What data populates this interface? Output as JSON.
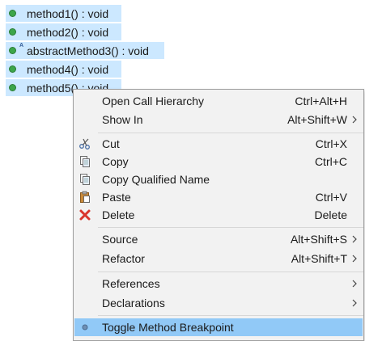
{
  "outline": {
    "items": [
      {
        "label": "method1() : void",
        "icon": "method-public-icon"
      },
      {
        "label": "method2() : void",
        "icon": "method-public-icon"
      },
      {
        "label": "abstractMethod3() : void",
        "icon": "method-abstract-icon",
        "badge": "A"
      },
      {
        "label": "method4() : void",
        "icon": "method-public-icon"
      },
      {
        "label": "method5() : void",
        "icon": "method-public-icon"
      }
    ],
    "selection_color": "#cce8ff",
    "method_icon_color": "#3da64a"
  },
  "context_menu": {
    "items": [
      {
        "label": "Open Call Hierarchy",
        "shortcut": "Ctrl+Alt+H"
      },
      {
        "label": "Show In",
        "shortcut": "Alt+Shift+W",
        "submenu": true
      },
      {
        "label": "Cut",
        "shortcut": "Ctrl+X",
        "icon": "scissors-icon"
      },
      {
        "label": "Copy",
        "shortcut": "Ctrl+C",
        "icon": "copy-icon"
      },
      {
        "label": "Copy Qualified Name",
        "shortcut": "",
        "icon": "copy-qualified-name-icon"
      },
      {
        "label": "Paste",
        "shortcut": "Ctrl+V",
        "icon": "paste-icon"
      },
      {
        "label": "Delete",
        "shortcut": "Delete",
        "icon": "delete-x-icon"
      },
      {
        "label": "Source",
        "shortcut": "Alt+Shift+S",
        "submenu": true
      },
      {
        "label": "Refactor",
        "shortcut": "Alt+Shift+T",
        "submenu": true
      },
      {
        "label": "References",
        "shortcut": "",
        "submenu": true
      },
      {
        "label": "Declarations",
        "shortcut": "",
        "submenu": true
      },
      {
        "label": "Toggle Method Breakpoint",
        "shortcut": "",
        "icon": "breakpoint-icon",
        "highlighted": true
      }
    ],
    "highlight_color": "#91c9f7",
    "background_color": "#f2f2f2"
  }
}
